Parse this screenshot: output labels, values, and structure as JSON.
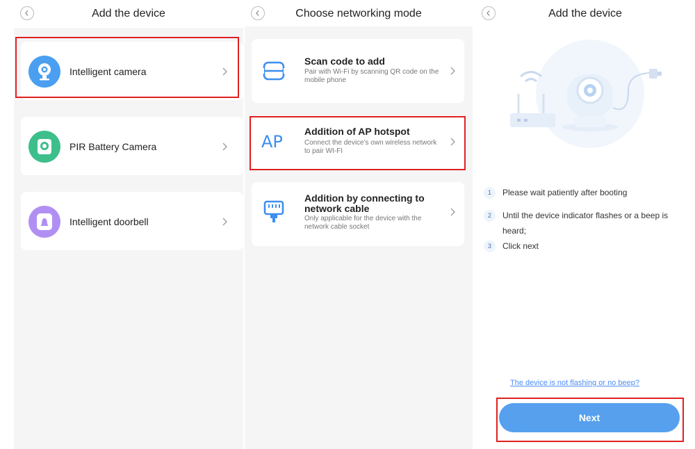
{
  "screen1": {
    "title": "Add the device",
    "devices": [
      {
        "label": "Intelligent camera",
        "icon": "camera-icon",
        "color": "#4a9ff0"
      },
      {
        "label": "PIR Battery Camera",
        "icon": "battery-camera-icon",
        "color": "#3dbf8c"
      },
      {
        "label": "Intelligent doorbell",
        "icon": "doorbell-icon",
        "color": "#b18ff2"
      }
    ]
  },
  "screen2": {
    "title": "Choose networking mode",
    "modes": [
      {
        "title": "Scan code to add",
        "desc": "Pair with Wi-Fi by scanning QR code on the mobile phone",
        "icon": "scan-icon"
      },
      {
        "title": "Addition of AP hotspot",
        "desc": "Connect the device's own wireless network to pair WI-FI",
        "icon": "ap-icon",
        "icon_text": "AP"
      },
      {
        "title": "Addition by connecting to network cable",
        "desc": "Only applicable for the device with the network cable socket",
        "icon": "ethernet-icon"
      }
    ]
  },
  "screen3": {
    "title": "Add the device",
    "steps": [
      {
        "num": "1",
        "text": "Please wait patiently after booting"
      },
      {
        "num": "2",
        "text": "Until the device indicator flashes or a beep is heard;"
      },
      {
        "num": "3",
        "text": "Click next"
      }
    ],
    "help_link": "The device is not flashing or no beep?",
    "next_label": "Next"
  },
  "colors": {
    "accent": "#56a0ee",
    "highlight": "#e02020",
    "link": "#4e8df5"
  }
}
